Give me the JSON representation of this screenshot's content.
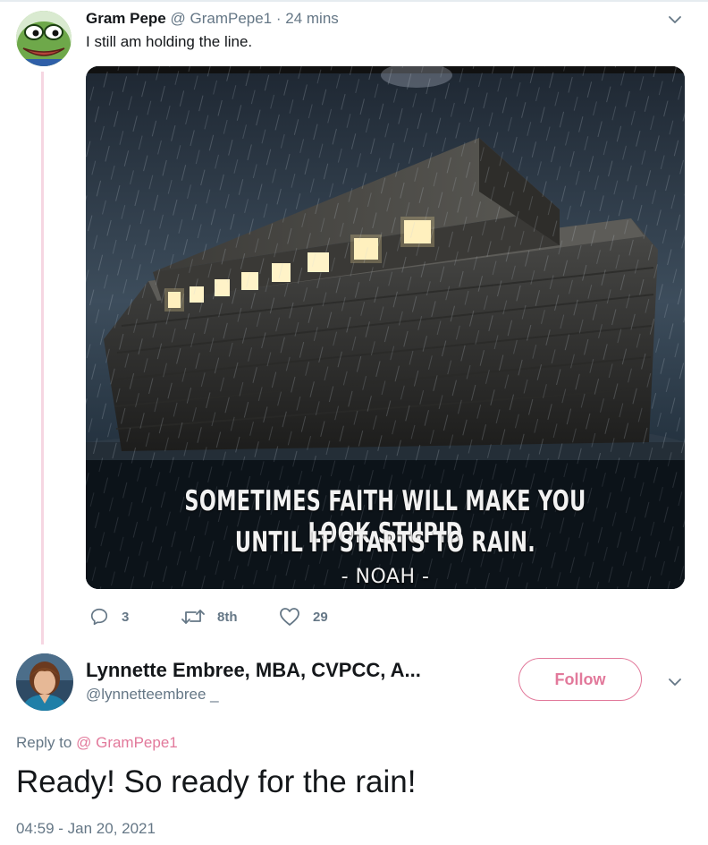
{
  "tweet1": {
    "display_name": "Gram Pepe",
    "handle": "@ GramPepe1",
    "time": "· 24 mins",
    "text": "I still am holding the line.",
    "media": {
      "caption_line1": "SOMETIMES FAITH WILL MAKE YOU LOOK STUPID",
      "caption_line2": "UNTIL IT STARTS TO RAIN.",
      "caption_attribution": "- NOAH -"
    },
    "actions": {
      "replies": "3",
      "retweets": "8th",
      "likes": "29"
    }
  },
  "tweet2": {
    "display_name": "Lynnette Embree, MBA, CVPCC, A...",
    "handle": "@lynnetteembree _",
    "follow_label": "Follow",
    "reply_to_label": "Reply to",
    "reply_to_handle": "@ GramPepe1",
    "text": "Ready! So ready for the rain!",
    "timestamp": "04:59 - Jan 20, 2021"
  },
  "colors": {
    "accent_pink": "#e2799b",
    "thread_line": "#f6d6e2",
    "muted": "#657786"
  },
  "icons": [
    "chevron-down-icon",
    "reply-icon",
    "retweet-icon",
    "like-icon"
  ]
}
